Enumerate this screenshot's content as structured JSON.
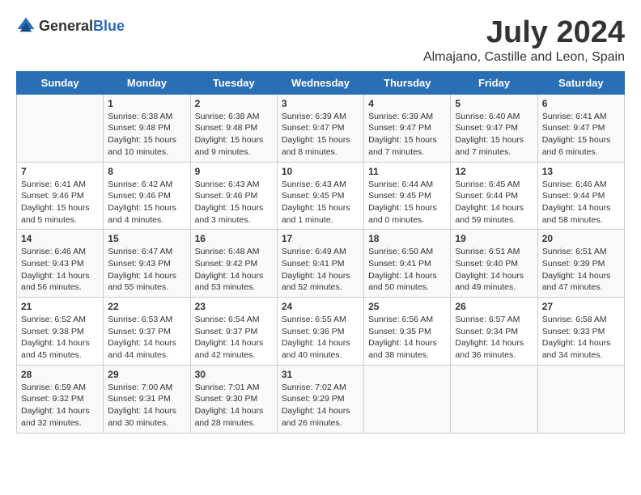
{
  "header": {
    "logo_general": "General",
    "logo_blue": "Blue",
    "month": "July 2024",
    "location": "Almajano, Castille and Leon, Spain"
  },
  "days_of_week": [
    "Sunday",
    "Monday",
    "Tuesday",
    "Wednesday",
    "Thursday",
    "Friday",
    "Saturday"
  ],
  "weeks": [
    [
      {
        "day": "",
        "info": ""
      },
      {
        "day": "1",
        "info": "Sunrise: 6:38 AM\nSunset: 9:48 PM\nDaylight: 15 hours\nand 10 minutes."
      },
      {
        "day": "2",
        "info": "Sunrise: 6:38 AM\nSunset: 9:48 PM\nDaylight: 15 hours\nand 9 minutes."
      },
      {
        "day": "3",
        "info": "Sunrise: 6:39 AM\nSunset: 9:47 PM\nDaylight: 15 hours\nand 8 minutes."
      },
      {
        "day": "4",
        "info": "Sunrise: 6:39 AM\nSunset: 9:47 PM\nDaylight: 15 hours\nand 7 minutes."
      },
      {
        "day": "5",
        "info": "Sunrise: 6:40 AM\nSunset: 9:47 PM\nDaylight: 15 hours\nand 7 minutes."
      },
      {
        "day": "6",
        "info": "Sunrise: 6:41 AM\nSunset: 9:47 PM\nDaylight: 15 hours\nand 6 minutes."
      }
    ],
    [
      {
        "day": "7",
        "info": "Sunrise: 6:41 AM\nSunset: 9:46 PM\nDaylight: 15 hours\nand 5 minutes."
      },
      {
        "day": "8",
        "info": "Sunrise: 6:42 AM\nSunset: 9:46 PM\nDaylight: 15 hours\nand 4 minutes."
      },
      {
        "day": "9",
        "info": "Sunrise: 6:43 AM\nSunset: 9:46 PM\nDaylight: 15 hours\nand 3 minutes."
      },
      {
        "day": "10",
        "info": "Sunrise: 6:43 AM\nSunset: 9:45 PM\nDaylight: 15 hours\nand 1 minute."
      },
      {
        "day": "11",
        "info": "Sunrise: 6:44 AM\nSunset: 9:45 PM\nDaylight: 15 hours\nand 0 minutes."
      },
      {
        "day": "12",
        "info": "Sunrise: 6:45 AM\nSunset: 9:44 PM\nDaylight: 14 hours\nand 59 minutes."
      },
      {
        "day": "13",
        "info": "Sunrise: 6:46 AM\nSunset: 9:44 PM\nDaylight: 14 hours\nand 58 minutes."
      }
    ],
    [
      {
        "day": "14",
        "info": "Sunrise: 6:46 AM\nSunset: 9:43 PM\nDaylight: 14 hours\nand 56 minutes."
      },
      {
        "day": "15",
        "info": "Sunrise: 6:47 AM\nSunset: 9:43 PM\nDaylight: 14 hours\nand 55 minutes."
      },
      {
        "day": "16",
        "info": "Sunrise: 6:48 AM\nSunset: 9:42 PM\nDaylight: 14 hours\nand 53 minutes."
      },
      {
        "day": "17",
        "info": "Sunrise: 6:49 AM\nSunset: 9:41 PM\nDaylight: 14 hours\nand 52 minutes."
      },
      {
        "day": "18",
        "info": "Sunrise: 6:50 AM\nSunset: 9:41 PM\nDaylight: 14 hours\nand 50 minutes."
      },
      {
        "day": "19",
        "info": "Sunrise: 6:51 AM\nSunset: 9:40 PM\nDaylight: 14 hours\nand 49 minutes."
      },
      {
        "day": "20",
        "info": "Sunrise: 6:51 AM\nSunset: 9:39 PM\nDaylight: 14 hours\nand 47 minutes."
      }
    ],
    [
      {
        "day": "21",
        "info": "Sunrise: 6:52 AM\nSunset: 9:38 PM\nDaylight: 14 hours\nand 45 minutes."
      },
      {
        "day": "22",
        "info": "Sunrise: 6:53 AM\nSunset: 9:37 PM\nDaylight: 14 hours\nand 44 minutes."
      },
      {
        "day": "23",
        "info": "Sunrise: 6:54 AM\nSunset: 9:37 PM\nDaylight: 14 hours\nand 42 minutes."
      },
      {
        "day": "24",
        "info": "Sunrise: 6:55 AM\nSunset: 9:36 PM\nDaylight: 14 hours\nand 40 minutes."
      },
      {
        "day": "25",
        "info": "Sunrise: 6:56 AM\nSunset: 9:35 PM\nDaylight: 14 hours\nand 38 minutes."
      },
      {
        "day": "26",
        "info": "Sunrise: 6:57 AM\nSunset: 9:34 PM\nDaylight: 14 hours\nand 36 minutes."
      },
      {
        "day": "27",
        "info": "Sunrise: 6:58 AM\nSunset: 9:33 PM\nDaylight: 14 hours\nand 34 minutes."
      }
    ],
    [
      {
        "day": "28",
        "info": "Sunrise: 6:59 AM\nSunset: 9:32 PM\nDaylight: 14 hours\nand 32 minutes."
      },
      {
        "day": "29",
        "info": "Sunrise: 7:00 AM\nSunset: 9:31 PM\nDaylight: 14 hours\nand 30 minutes."
      },
      {
        "day": "30",
        "info": "Sunrise: 7:01 AM\nSunset: 9:30 PM\nDaylight: 14 hours\nand 28 minutes."
      },
      {
        "day": "31",
        "info": "Sunrise: 7:02 AM\nSunset: 9:29 PM\nDaylight: 14 hours\nand 26 minutes."
      },
      {
        "day": "",
        "info": ""
      },
      {
        "day": "",
        "info": ""
      },
      {
        "day": "",
        "info": ""
      }
    ]
  ]
}
